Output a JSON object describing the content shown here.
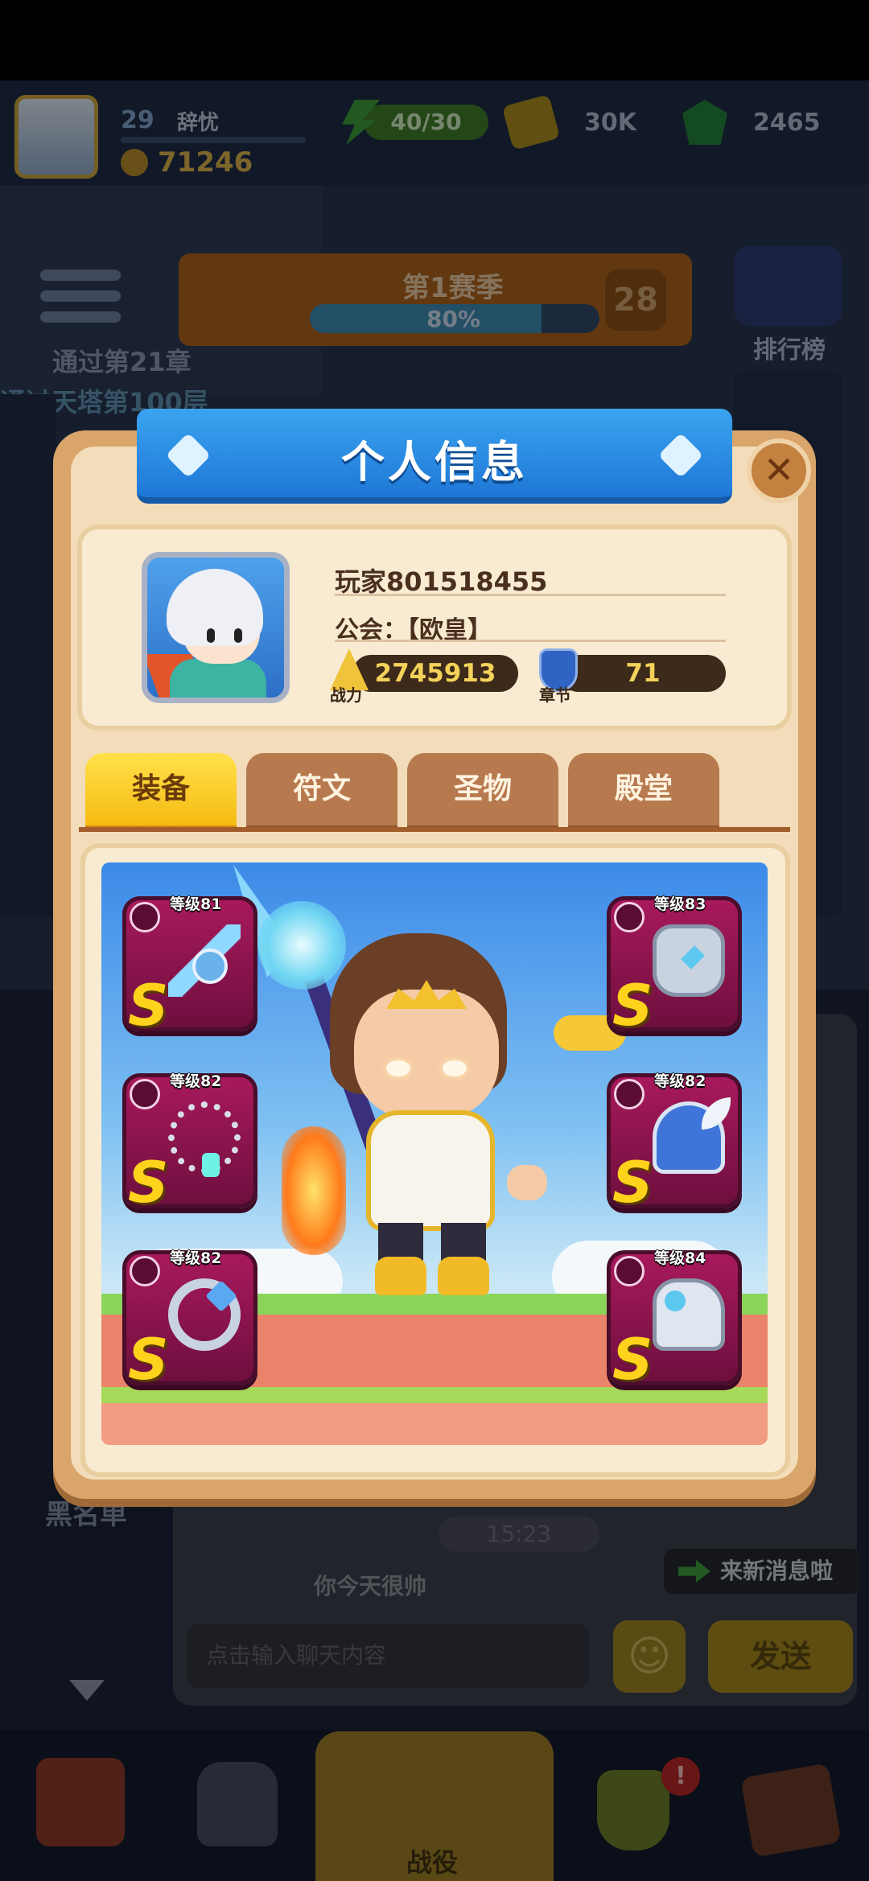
{
  "hud": {
    "level": "29",
    "player_name": "辞忧",
    "gold": "71246",
    "energy": "40/30",
    "coins": "30K",
    "gems": "2465"
  },
  "background": {
    "chapter_text": "通过第21章",
    "tower_text": "通过天塔第100层",
    "season_title": "第1赛季",
    "season_progress": "80%",
    "season_level": "28",
    "rank_label": "排行榜",
    "blacklist_label": "黑名单",
    "chat_time": "15:23",
    "new_message_label": "来新消息啦",
    "chat_message": "你今天很帅",
    "chat_placeholder": "点击输入聊天内容",
    "send_label": "发送",
    "emoji_icon": "smiley-icon",
    "nav_battle_label": "战役",
    "nav_alert": "!"
  },
  "modal": {
    "title": "个人信息",
    "close_symbol": "✕",
    "player_name": "玩家801518455",
    "guild": "公会：【欧皇】",
    "power_value": "2745913",
    "power_label": "战力",
    "chapter_value": "71",
    "chapter_label": "章节",
    "tabs": [
      {
        "label": "装备",
        "active": true
      },
      {
        "label": "符文",
        "active": false
      },
      {
        "label": "圣物",
        "active": false
      },
      {
        "label": "殿堂",
        "active": false
      }
    ],
    "equipment": [
      {
        "slot": "weapon",
        "level": "等级81",
        "grade": "S",
        "icon": "spear-icon"
      },
      {
        "slot": "armor",
        "level": "等级83",
        "grade": "S",
        "icon": "armor-icon"
      },
      {
        "slot": "necklace",
        "level": "等级82",
        "grade": "S",
        "icon": "necklace-icon"
      },
      {
        "slot": "helmet",
        "level": "等级82",
        "grade": "S",
        "icon": "helmet-icon"
      },
      {
        "slot": "ring",
        "level": "等级82",
        "grade": "S",
        "icon": "ring-icon"
      },
      {
        "slot": "boots",
        "level": "等级84",
        "grade": "S",
        "icon": "boots-icon"
      }
    ]
  },
  "colors": {
    "banner_blue": "#1f77d6",
    "active_tab_yellow": "#f5b80e",
    "slot_magenta": "#a8195c",
    "grade_gold": "#ffd21c"
  }
}
